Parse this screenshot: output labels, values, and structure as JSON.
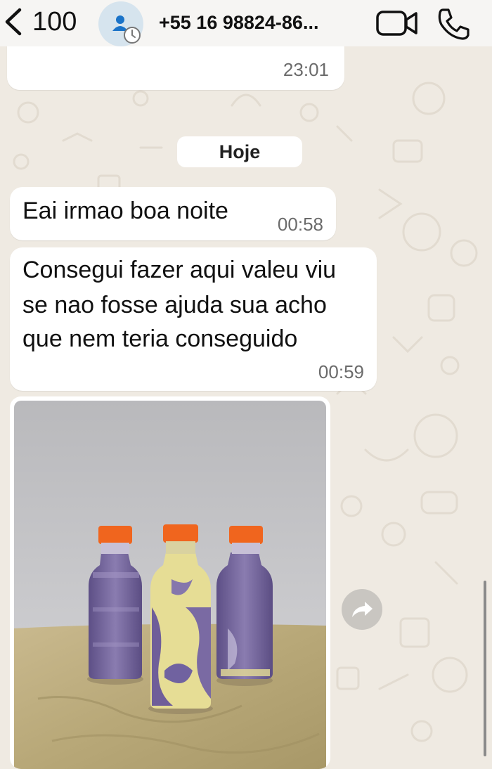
{
  "header": {
    "back_count": "100",
    "contact_name": "+55 16 98824-86...",
    "icons": {
      "back": "chevron-left-icon",
      "avatar": "person-icon",
      "disappearing": "timer-icon",
      "video": "video-camera-icon",
      "call": "phone-icon"
    }
  },
  "chat": {
    "date_separator": "Hoje",
    "messages": [
      {
        "text_lines": [],
        "time": "23:01",
        "direction": "incoming"
      },
      {
        "text_lines": [
          "Eai irmao boa noite"
        ],
        "time": "00:58",
        "direction": "incoming"
      },
      {
        "text_lines": [
          "Consegui fazer aqui valeu viu",
          "se nao fosse ajuda sua acho",
          "que nem teria conseguido"
        ],
        "time": "00:59",
        "direction": "incoming"
      },
      {
        "type": "image",
        "direction": "incoming",
        "content": "photo of three bottles with orange caps"
      }
    ],
    "forward_icon": "forward-arrow-icon"
  },
  "colors": {
    "wallpaper": "#efeae2",
    "bubble": "#ffffff",
    "header": "#f6f5f3",
    "cap_orange": "#f0651e",
    "purple_drink": "#6f5e99"
  }
}
